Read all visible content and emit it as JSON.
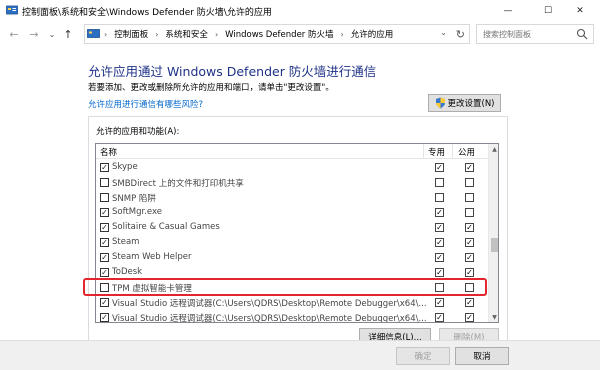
{
  "window": {
    "title": "控制面板\\系统和安全\\Windows Defender 防火墙\\允许的应用",
    "minimize_glyph": "—",
    "maximize_glyph": "☐",
    "close_glyph": "✕"
  },
  "nav": {
    "back_glyph": "←",
    "forward_glyph": "→",
    "recent_glyph": "⌄",
    "up_glyph": "↑",
    "breadcrumbs": [
      "控制面板",
      "系统和安全",
      "Windows Defender 防火墙",
      "允许的应用"
    ],
    "search_placeholder": "搜索控制面板"
  },
  "main": {
    "heading": "允许应用通过 Windows Defender 防火墙进行通信",
    "description": "若要添加、更改或删除所允许的应用和端口，请单击\"更改设置\"。",
    "risk_link": "允许应用进行通信有哪些风险?",
    "change_settings_button": "更改设置(N)",
    "group_label": "允许的应用和功能(A):",
    "columns": {
      "name": "名称",
      "private": "专用",
      "public": "公用"
    },
    "apps": [
      {
        "name": "Skype",
        "enabled": true,
        "private": true,
        "public": true
      },
      {
        "name": "SMBDirect 上的文件和打印机共享",
        "enabled": false,
        "private": false,
        "public": false
      },
      {
        "name": "SNMP 陷阱",
        "enabled": false,
        "private": false,
        "public": false
      },
      {
        "name": "SoftMgr.exe",
        "enabled": true,
        "private": true,
        "public": false
      },
      {
        "name": "Solitaire & Casual Games",
        "enabled": true,
        "private": true,
        "public": true
      },
      {
        "name": "Steam",
        "enabled": true,
        "private": true,
        "public": true
      },
      {
        "name": "Steam Web Helper",
        "enabled": true,
        "private": true,
        "public": true
      },
      {
        "name": "ToDesk",
        "enabled": true,
        "private": true,
        "public": true
      },
      {
        "name": "TPM 虚拟智能卡管理",
        "enabled": false,
        "private": false,
        "public": false
      },
      {
        "name": "Visual Studio 远程调试器(C:\\Users\\QDRS\\Desktop\\Remote Debugger\\x64\\...",
        "enabled": true,
        "private": true,
        "public": true
      },
      {
        "name": "Visual Studio 远程调试器(C:\\Users\\QDRS\\Desktop\\Remote Debugger\\x64\\...",
        "enabled": true,
        "private": true,
        "public": true
      }
    ],
    "details_button": "详细信息(L)...",
    "remove_button": "删除(M)"
  },
  "footer": {
    "ok_button": "确定",
    "cancel_button": "取消"
  },
  "colors": {
    "heading": "#1e3287",
    "link": "#0066cc",
    "highlight": "#e3262d"
  }
}
